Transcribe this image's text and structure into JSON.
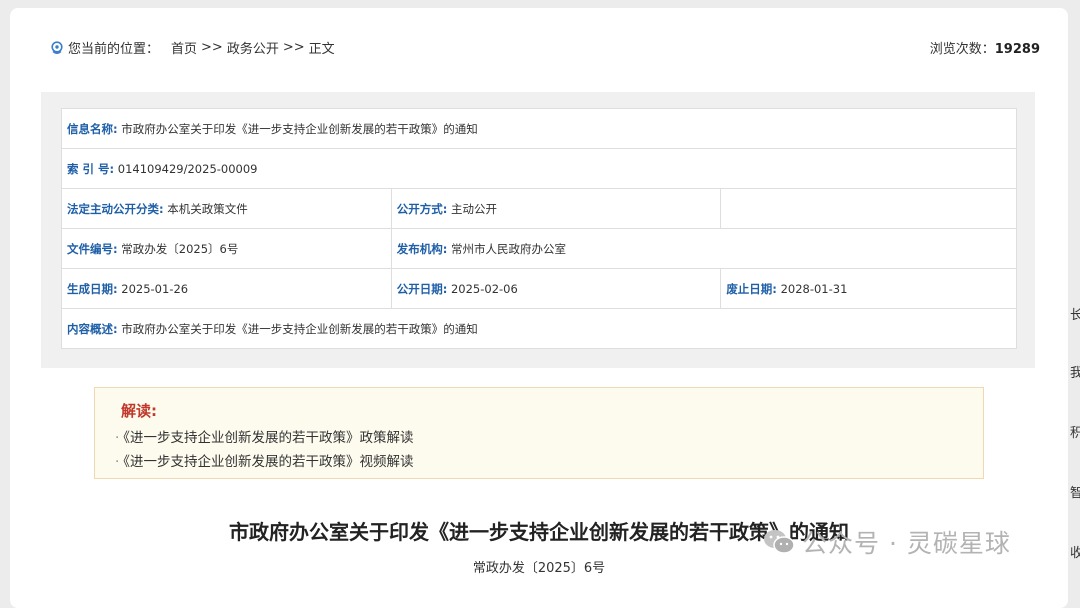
{
  "breadcrumb": {
    "label": "您当前的位置：",
    "items": [
      "首页",
      "政务公开",
      "正文"
    ],
    "separator": ">>"
  },
  "views": {
    "label": "浏览次数：",
    "count": "19289"
  },
  "info": {
    "title_key": "信息名称:",
    "title_val": "市政府办公室关于印发《进一步支持企业创新发展的若干政策》的通知",
    "index_key": "索 引 号:",
    "index_val": "014109429/2025-00009",
    "category_key": "法定主动公开分类:",
    "category_val": "本机关政策文件",
    "method_key": "公开方式:",
    "method_val": "主动公开",
    "docno_key": "文件编号:",
    "docno_val": "常政办发〔2025〕6号",
    "org_key": "发布机构:",
    "org_val": "常州市人民政府办公室",
    "created_key": "生成日期:",
    "created_val": "2025-01-26",
    "published_key": "公开日期:",
    "published_val": "2025-02-06",
    "expire_key": "废止日期:",
    "expire_val": "2028-01-31",
    "summary_key": "内容概述:",
    "summary_val": "市政府办公室关于印发《进一步支持企业创新发展的若干政策》的通知"
  },
  "interpretation": {
    "title": "解读:",
    "links": [
      "《进一步支持企业创新发展的若干政策》政策解读",
      "《进一步支持企业创新发展的若干政策》视频解读"
    ]
  },
  "document": {
    "title": "市政府办公室关于印发《进一步支持企业创新发展的若干政策》的通知",
    "number": "常政办发〔2025〕6号"
  },
  "watermark": {
    "text": "公众号 · 灵碳星球"
  },
  "edge_chars": [
    "长",
    "我",
    "积",
    "智",
    "收"
  ],
  "colors": {
    "key_blue": "#1f5fa8",
    "interp_red": "#c0392b",
    "interp_bg": "#fdfaee"
  }
}
